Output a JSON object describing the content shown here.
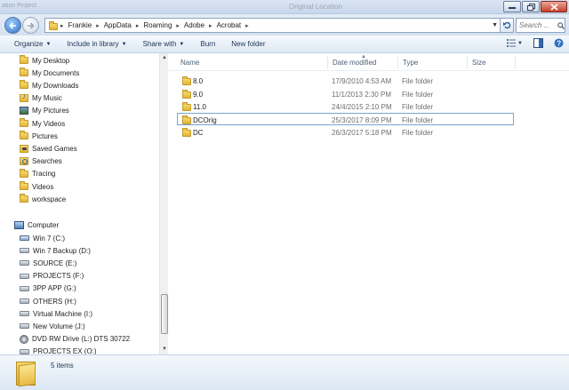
{
  "window": {
    "title": "Original Location",
    "title_left": "ation Project"
  },
  "address": {
    "crumbs": [
      "Frankie",
      "AppData",
      "Roaming",
      "Adobe",
      "Acrobat"
    ],
    "search_placeholder": "Search ..."
  },
  "toolbar": {
    "organize": "Organize",
    "include_in_library": "Include in library",
    "share_with": "Share with",
    "burn": "Burn",
    "new_folder": "New folder"
  },
  "nav": {
    "items": [
      {
        "label": "My Desktop",
        "icon": "folder-icon"
      },
      {
        "label": "My Documents",
        "icon": "folder-icon"
      },
      {
        "label": "My Downloads",
        "icon": "folder-icon"
      },
      {
        "label": "My Music",
        "icon": "music-folder-icon"
      },
      {
        "label": "My Pictures",
        "icon": "pictures-folder-icon"
      },
      {
        "label": "My Videos",
        "icon": "folder-icon"
      },
      {
        "label": "Pictures",
        "icon": "folder-icon"
      },
      {
        "label": "Saved Games",
        "icon": "saved-games-icon"
      },
      {
        "label": "Searches",
        "icon": "searches-icon"
      },
      {
        "label": "Tracing",
        "icon": "folder-icon"
      },
      {
        "label": "Videos",
        "icon": "folder-icon"
      },
      {
        "label": "workspace",
        "icon": "folder-icon"
      }
    ],
    "computer": "Computer",
    "drives": [
      {
        "label": "Win 7 (C:)",
        "icon": "system-drive-icon"
      },
      {
        "label": "Win 7 Backup (D:)",
        "icon": "drive-icon"
      },
      {
        "label": "SOURCE (E:)",
        "icon": "drive-icon"
      },
      {
        "label": "PROJECTS (F:)",
        "icon": "drive-icon"
      },
      {
        "label": "3PP APP (G:)",
        "icon": "drive-icon"
      },
      {
        "label": "OTHERS (H:)",
        "icon": "drive-icon"
      },
      {
        "label": "Virtual Machine (I:)",
        "icon": "drive-icon"
      },
      {
        "label": "New Volume (J:)",
        "icon": "drive-icon"
      },
      {
        "label": "DVD RW Drive (L:) DTS 30722",
        "icon": "dvd-drive-icon"
      },
      {
        "label": "PROJECTS EX (O:)",
        "icon": "drive-icon"
      }
    ]
  },
  "columns": {
    "name": "Name",
    "date": "Date modified",
    "type": "Type",
    "size": "Size"
  },
  "files": [
    {
      "name": "8.0",
      "date": "17/9/2010 4:53 AM",
      "type": "File folder"
    },
    {
      "name": "9.0",
      "date": "11/1/2013 2:30 PM",
      "type": "File folder"
    },
    {
      "name": "11.0",
      "date": "24/4/2015 2:10 PM",
      "type": "File folder"
    },
    {
      "name": "DCOrig",
      "date": "25/3/2017 8:09 PM",
      "type": "File folder"
    },
    {
      "name": "DC",
      "date": "26/3/2017 5:18 PM",
      "type": "File folder"
    }
  ],
  "status": {
    "item_count": "5 items"
  },
  "colors": {
    "chrome_top": "#dbe6f3",
    "toolbar_text": "#1e3351",
    "focus_border": "#7da2ce",
    "folder_yellow": "#e0b43a"
  }
}
